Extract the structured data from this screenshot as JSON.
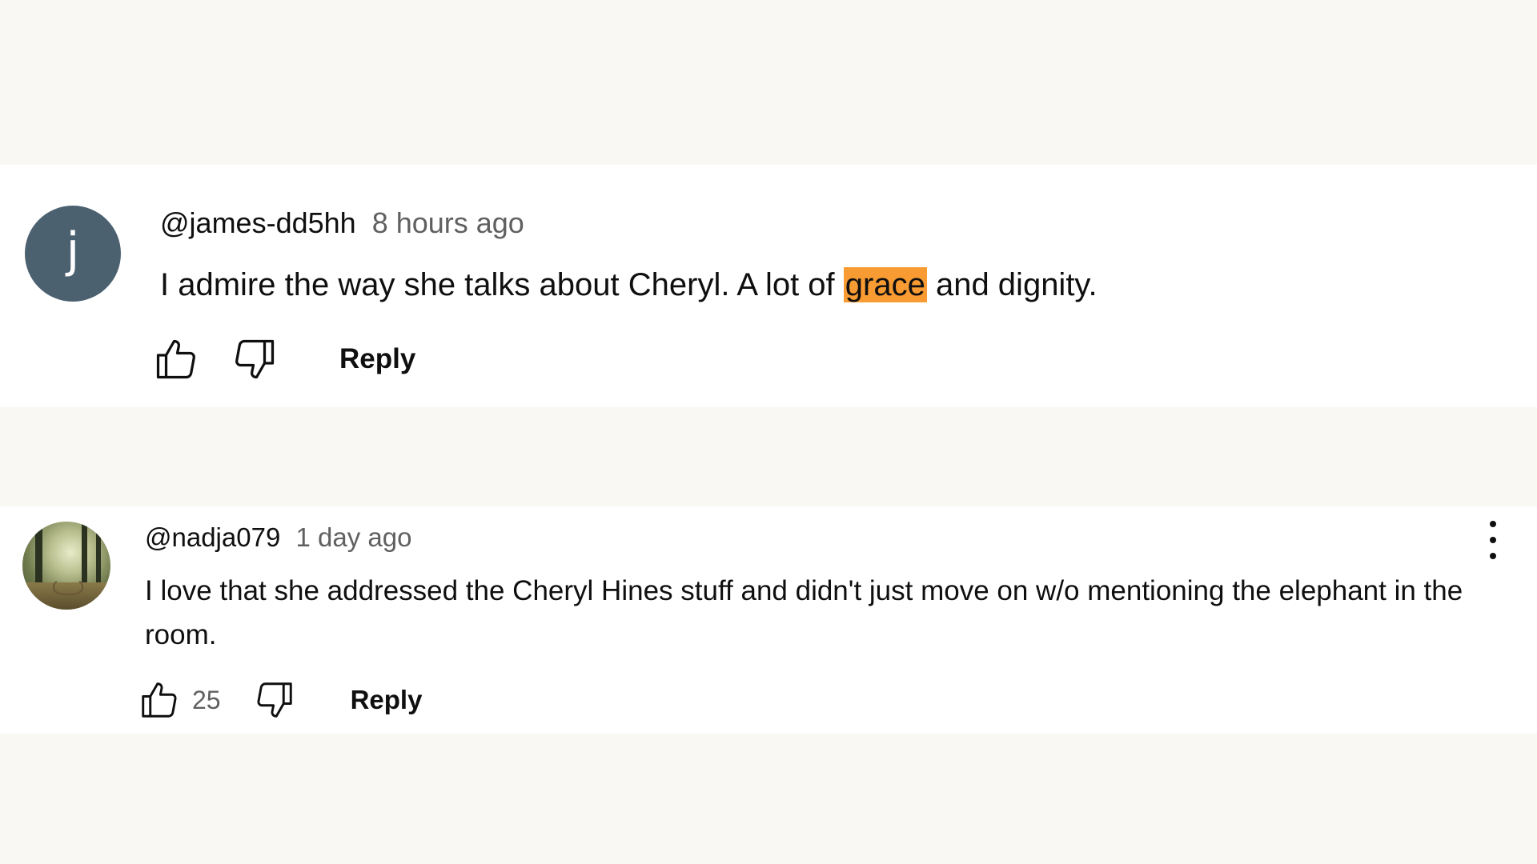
{
  "colors": {
    "page_background": "#faf8f2",
    "card_background": "#ffffff",
    "highlight": "#f89b32",
    "avatar1_background": "#4c6170",
    "text_primary": "#0f0f0f",
    "text_secondary": "#606060"
  },
  "comments": [
    {
      "avatar_letter": "j",
      "handle": "@james-dd5hh",
      "time": "8 hours ago",
      "text_before": "I admire the way she talks about Cheryl. A lot of ",
      "text_highlight": "grace",
      "text_after": " and dignity.",
      "like_count": "",
      "reply_label": "Reply",
      "icons": [
        "thumb-up-icon",
        "thumb-down-icon"
      ]
    },
    {
      "avatar_letter": "",
      "handle": "@nadja079",
      "time": "1 day ago",
      "text": "I love that she addressed the Cheryl Hines stuff and didn't just move on w/o mentioning the elephant in the room.",
      "like_count": "25",
      "reply_label": "Reply",
      "icons": [
        "thumb-up-icon",
        "thumb-down-icon",
        "more-vert-icon"
      ]
    }
  ]
}
